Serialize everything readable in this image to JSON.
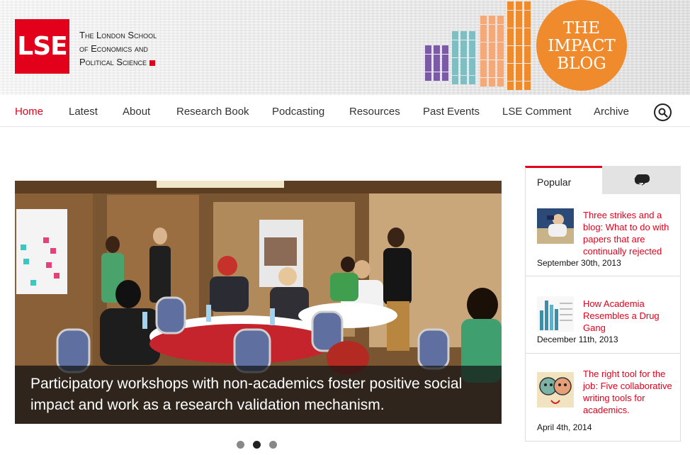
{
  "brand": {
    "logo_text": "LSE",
    "name_lines": [
      "The London School",
      "of Economics and",
      "Political Science"
    ],
    "colors": {
      "red": "#e3001b",
      "orange": "#f08b2d",
      "purple": "#7b5aa6",
      "teal": "#7fbfc4",
      "peach": "#f5a878"
    }
  },
  "impact_blog": {
    "lines": [
      "THE",
      "IMPACT",
      "BLOG"
    ]
  },
  "nav": {
    "items": [
      {
        "label": "Home",
        "active": true
      },
      {
        "label": "Latest"
      },
      {
        "label": "About"
      },
      {
        "label": "Research Book"
      },
      {
        "label": "Podcasting"
      },
      {
        "label": "Resources"
      },
      {
        "label": "Past Events"
      },
      {
        "label": "LSE Comment"
      },
      {
        "label": "Archive"
      }
    ],
    "search_icon": "search-icon"
  },
  "hero": {
    "caption": "Participatory workshops with non-academics foster positive social impact and work as a research validation mechanism.",
    "slides": 3,
    "active_slide": 2
  },
  "sidebar": {
    "tabs": {
      "popular_label": "Popular",
      "comments_icon": "comments-icon"
    },
    "popular": [
      {
        "title": "Three strikes and a blog: What to do with papers that are continually rejected",
        "date": "September 30th, 2013",
        "thumb_icon": "baseball-thumbnail"
      },
      {
        "title": "How Academia Resembles a Drug Gang",
        "date": "December 11th, 2013",
        "thumb_icon": "bar-chart-thumbnail"
      },
      {
        "title": "The right tool for the job: Five collaborative writing tools for academics.",
        "date": "April 4th, 2014",
        "thumb_icon": "faces-thumbnail"
      }
    ]
  }
}
